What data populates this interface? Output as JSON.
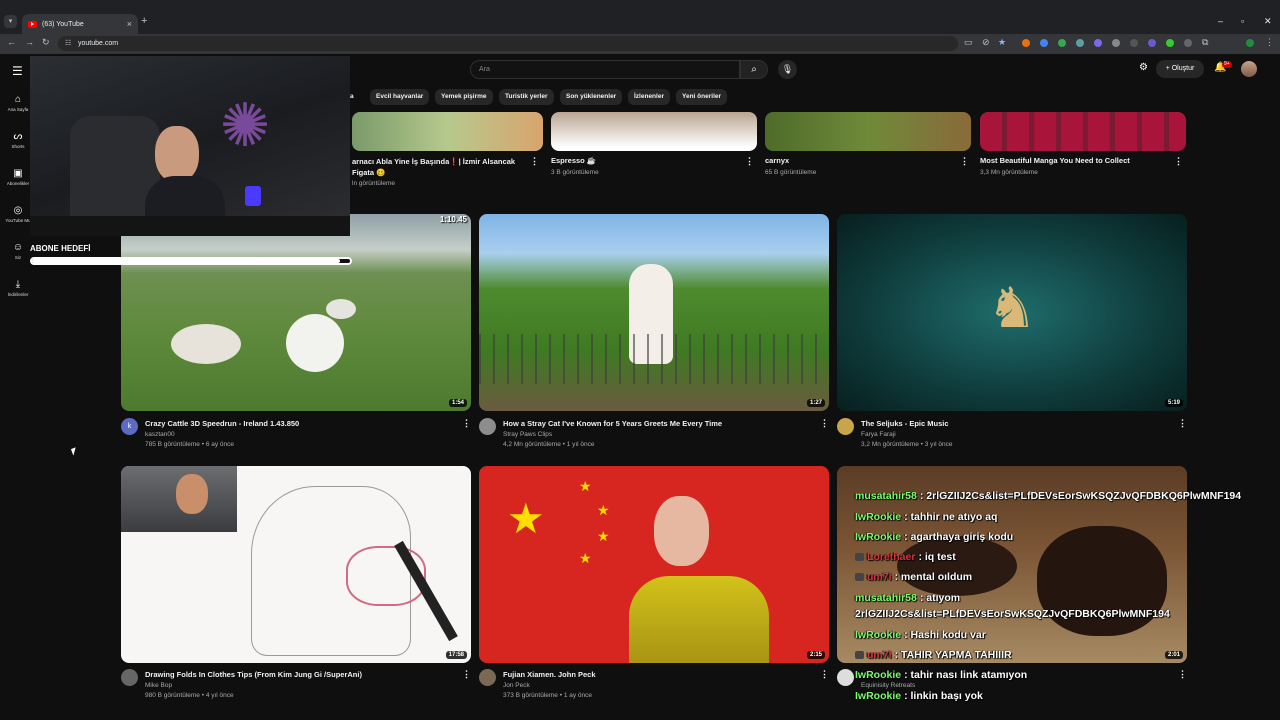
{
  "browser": {
    "tab_title": "(63) YouTube",
    "tab_close": "×",
    "new_tab": "+",
    "url": "youtube.com",
    "win_min": "–",
    "win_max": "▫",
    "win_close": "✕"
  },
  "header": {
    "search_placeholder": "Ara",
    "create_label": "Oluştur",
    "notifications_badge": "9+"
  },
  "chips": [
    "ğa",
    "Evcil hayvanlar",
    "Yemek pişirme",
    "Turistik yerler",
    "Son yüklenenler",
    "İzlenenler",
    "Yeni öneriler"
  ],
  "rail": [
    {
      "label": "Ana Sayfa",
      "icon": "home-icon"
    },
    {
      "label": "Shorts",
      "icon": "shorts-icon"
    },
    {
      "label": "Abonelikler",
      "icon": "subscriptions-icon"
    },
    {
      "label": "YouTube Mu",
      "icon": "youtube-music-icon"
    },
    {
      "label": "Siz",
      "icon": "user-icon"
    },
    {
      "label": "İndirilenler",
      "icon": "download-icon"
    }
  ],
  "row1": [
    {
      "title": "arnacı Abla Yine İş Başında❗| İzmir Alsancak Figata 🥴",
      "meta": "ln görüntüleme"
    },
    {
      "title": "Espresso ☕",
      "meta": "3 B görüntüleme"
    },
    {
      "title": "carnyx",
      "meta": "65 B görüntüleme"
    },
    {
      "title": "Most Beautiful Manga You Need to Collect",
      "meta": "3,3 Mn görüntüleme"
    }
  ],
  "row2": [
    {
      "title": "Crazy Cattle 3D Speedrun - Ireland 1.43.850",
      "channel": "kasztan00",
      "meta": "785 B görüntüleme • 6 ay önce",
      "duration": "1:54",
      "avatar": "k",
      "overlay_time": "1:10.45"
    },
    {
      "title": "How a Stray Cat I've Known for 5 Years Greets Me Every Time",
      "channel": "Stray Paws Clips",
      "meta": "4,2 Mn görüntüleme • 1 yıl önce",
      "duration": "1:27"
    },
    {
      "title": "The Seljuks - Epic Music",
      "channel": "Farya Faraji",
      "meta": "3,2 Mn görüntüleme • 3 yıl önce",
      "duration": "5:19"
    }
  ],
  "row3": [
    {
      "title": "Drawing Folds In Clothes Tips (From Kim Jung Gi /SuperAni)",
      "channel": "Mike Bop",
      "meta": "980 B görüntüleme • 4 yıl önce",
      "duration": "17:58"
    },
    {
      "title": "Fujian Xiamen. John Peck",
      "channel": "Jon Peck",
      "meta": "373 B görüntüleme • 1 ay önce",
      "duration": "2:15"
    },
    {
      "title": "",
      "channel": "Equinisity Retreats",
      "meta": "",
      "duration": "2:01"
    }
  ],
  "overlay": {
    "goal_label": "ABONE HEDEFİ",
    "goal_progress": 0.97
  },
  "chat": [
    {
      "user": "musatahir58",
      "msg": ": 2rlGZIIJ2Cs&list=PLfDEVsEorSwKSQZJvQFDBKQ6PlwMNF194",
      "color": "green",
      "badge": false
    },
    {
      "user": "IwRookie",
      "msg": ": tahhir ne atıyo aq",
      "color": "green",
      "badge": false
    },
    {
      "user": "IwRookie",
      "msg": ": agarthaya giriş kodu",
      "color": "green",
      "badge": false
    },
    {
      "user": "Lorethaer",
      "msg": ": iq test",
      "color": "red",
      "badge": true
    },
    {
      "user": "um7i",
      "msg": ": mental oıldum",
      "color": "red",
      "badge": true
    },
    {
      "user": "musatahir58",
      "msg": ": atıyom",
      "color": "green",
      "badge": false
    },
    {
      "user": "",
      "msg": "2rlGZIIJ2Cs&list=PLfDEVsEorSwKSQZJvQFDBKQ6PlwMNF194",
      "color": "green",
      "badge": false
    },
    {
      "user": "IwRookie",
      "msg": ": Hashi kodu var",
      "color": "green",
      "badge": false
    },
    {
      "user": "um7i",
      "msg": ": TAHIR YAPMA TAHIIIR",
      "color": "red",
      "badge": true
    },
    {
      "user": "IwRookie",
      "msg": ": tahir nası link atamıyon",
      "color": "green",
      "badge": false
    },
    {
      "user": "IwRookie",
      "msg": ": linkin başı yok",
      "color": "green",
      "badge": false
    }
  ],
  "colors": {
    "youtube_red": "#ff0000",
    "chat_green": "#7cfc6a",
    "chat_red": "#e0323a",
    "background": "#0f0f0f"
  }
}
